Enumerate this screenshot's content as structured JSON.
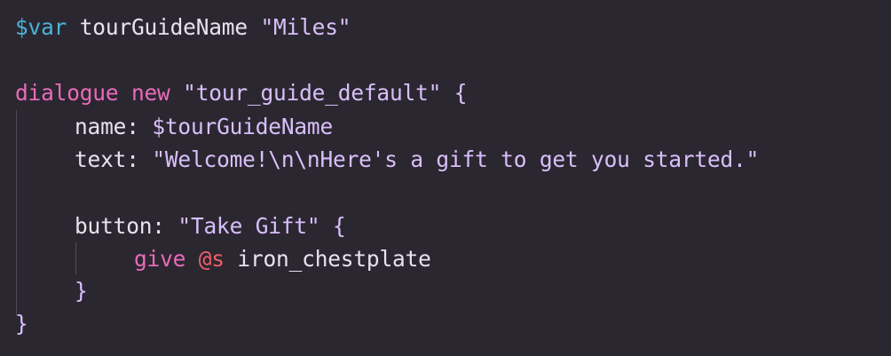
{
  "editor": {
    "background": "#2b2730",
    "lines": {
      "l1": {
        "var_kw": "$var",
        "name": " tourGuideName ",
        "value": "\"Miles\""
      },
      "l3": {
        "kw": "dialogue",
        "new_kw": " new ",
        "id": "\"tour_guide_default\"",
        "brace": " {"
      },
      "l4": {
        "prop": "name: ",
        "value": "$tourGuideName"
      },
      "l5": {
        "prop": "text: ",
        "value": "\"Welcome!\\n\\nHere's a gift to get you started.\""
      },
      "l7": {
        "prop": "button: ",
        "value": "\"Take Gift\"",
        "brace": " {"
      },
      "l8": {
        "cmd": "give",
        "selector": " @s",
        "item": " iron_chestplate"
      },
      "l9": {
        "brace": "}"
      },
      "l10": {
        "brace": "}"
      }
    }
  }
}
